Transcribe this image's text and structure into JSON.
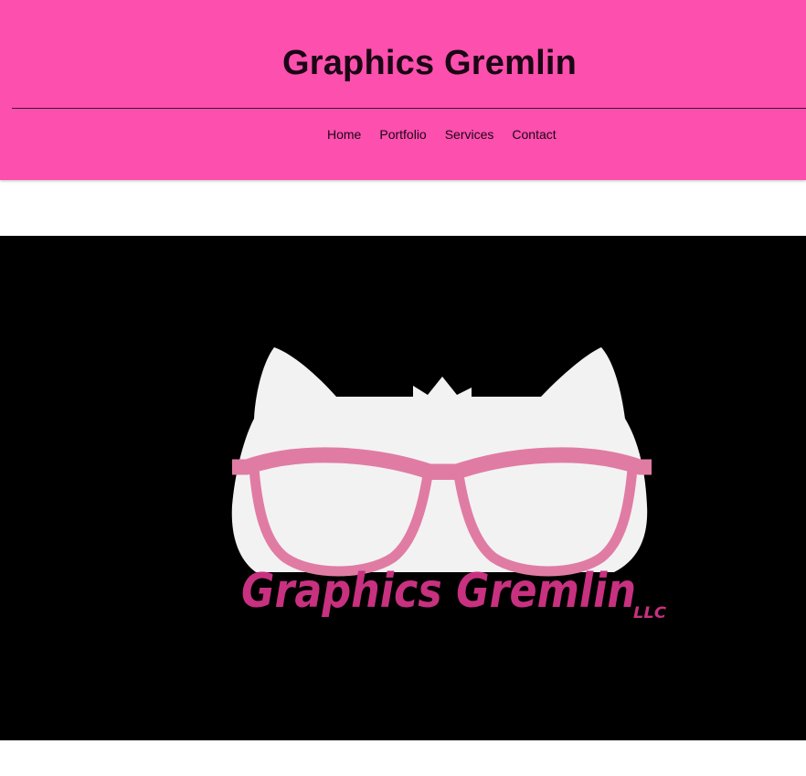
{
  "site": {
    "title": "Graphics Gremlin"
  },
  "nav": {
    "items": [
      {
        "label": "Home"
      },
      {
        "label": "Portfolio"
      },
      {
        "label": "Services"
      },
      {
        "label": "Contact"
      }
    ]
  },
  "hero": {
    "logo_text": "Graphics Gremlin",
    "logo_suffix": "LLC"
  },
  "colors": {
    "header_bg": "#fc4fae",
    "hero_bg": "#000000",
    "cat_fill": "#f3f2f3",
    "glasses": "#e07ca3",
    "logo_text": "#c8317f"
  }
}
